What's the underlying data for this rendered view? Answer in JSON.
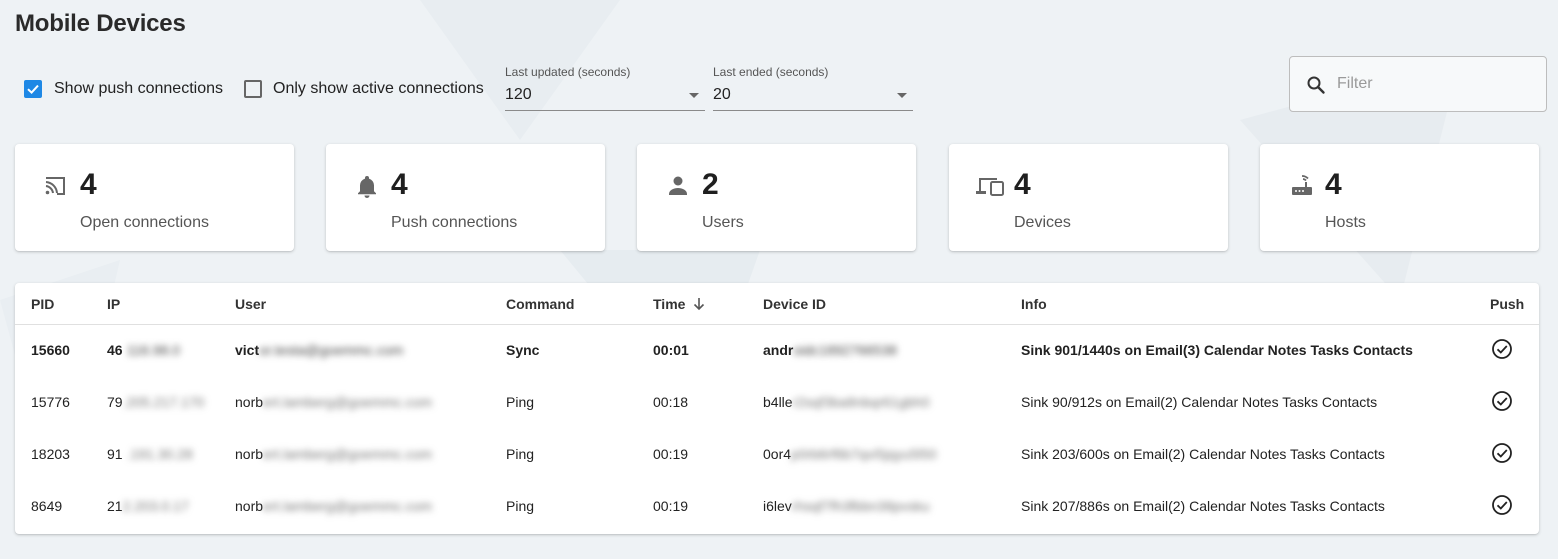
{
  "page": {
    "title": "Mobile Devices"
  },
  "toolbar": {
    "show_push": {
      "label": "Show push connections",
      "checked": true
    },
    "only_active": {
      "label": "Only show active connections",
      "checked": false
    },
    "last_updated": {
      "label": "Last updated (seconds)",
      "value": "120"
    },
    "last_ended": {
      "label": "Last ended (seconds)",
      "value": "20"
    },
    "filter": {
      "placeholder": "Filter",
      "value": "",
      "icon": "search-icon"
    }
  },
  "stats": [
    {
      "icon": "cast-icon",
      "value": "4",
      "label": "Open connections"
    },
    {
      "icon": "bell-icon",
      "value": "4",
      "label": "Push connections"
    },
    {
      "icon": "person-icon",
      "value": "2",
      "label": "Users"
    },
    {
      "icon": "devices-icon",
      "value": "4",
      "label": "Devices"
    },
    {
      "icon": "router-icon",
      "value": "4",
      "label": "Hosts"
    }
  ],
  "table": {
    "columns": [
      "PID",
      "IP",
      "User",
      "Command",
      "Time",
      "Device ID",
      "Info",
      "Push"
    ],
    "sort": {
      "column": "Time",
      "direction": "descending"
    },
    "rows": [
      {
        "pid": "15660",
        "ip_visible": "46",
        "ip_hidden": "116.98.0",
        "user_visible": "vict",
        "user_hidden": "or.testa@goemmc.com",
        "command": "Sync",
        "time": "00:01",
        "device_visible": "andr",
        "device_hidden": "oidc1892766538",
        "info": "Sink 901/1440s on Email(3) Calendar Notes Tasks Contacts",
        "push": true
      },
      {
        "pid": "15776",
        "ip_visible": "79",
        "ip_hidden": ".205.217.170",
        "user_visible": "norb",
        "user_hidden": "ert.lamberg@goemmc.com",
        "command": "Ping",
        "time": "00:18",
        "device_visible": "b4lle",
        "device_hidden": "r2sqf3ba8nbqr61gbh0",
        "info": "Sink 90/912s on Email(2) Calendar Notes Tasks Contacts",
        "push": true
      },
      {
        "pid": "18203",
        "ip_visible": "91",
        "ip_hidden": ".191.30.28",
        "user_visible": "norb",
        "user_hidden": "ert.lamberg@goemmc.com",
        "command": "Ping",
        "time": "00:19",
        "device_visible": "0or4",
        "device_hidden": "p0rb6rf6b7qvi5jqyu5l50",
        "info": "Sink 203/600s on Email(2) Calendar Notes Tasks Contacts",
        "push": true
      },
      {
        "pid": "8649",
        "ip_visible": "21",
        "ip_hidden": "2.203.0.17",
        "user_visible": "norb",
        "user_hidden": "ert.lamberg@goemmc.com",
        "command": "Ping",
        "time": "00:19",
        "device_visible": "i6lev",
        "device_hidden": "rhsqf7fh3fbbn38pvsku",
        "info": "Sink 207/886s on Email(2) Calendar Notes Tasks Contacts",
        "push": true
      }
    ]
  }
}
